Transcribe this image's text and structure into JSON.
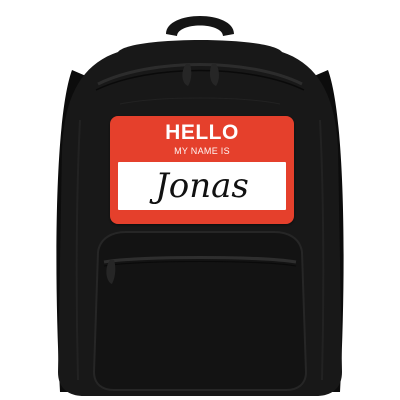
{
  "name_tag": {
    "greeting": "HELLO",
    "subtitle": "MY NAME IS",
    "name": "Jonas"
  },
  "colors": {
    "tag_red": "#e5402c",
    "bag_black": "#151515"
  }
}
